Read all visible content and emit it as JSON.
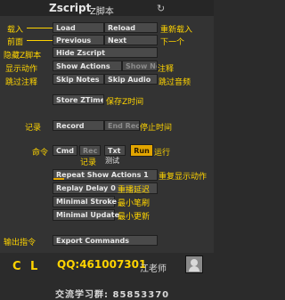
{
  "panel": {
    "title": "Zscript",
    "title_note": "Z脚本",
    "refresh_icon": "↻"
  },
  "buttons": {
    "load": "Load",
    "reload": "Reload",
    "previous": "Previous",
    "next": "Next",
    "hide_zscript": "Hide Zscript",
    "show_actions": "Show Actions",
    "show_notes": "Show Notes",
    "skip_notes": "Skip Notes",
    "skip_audio": "Skip Audio",
    "store_ztime": "Store ZTime",
    "record": "Record",
    "end_rec": "End Rec",
    "cmd": "Cmd",
    "rec": "Rec",
    "txt": "Txt",
    "run": "Run",
    "export_commands": "Export Commands"
  },
  "sliders": {
    "repeat_show_actions": {
      "label": "Repeat Show Actions",
      "value": "1",
      "level": 0.1
    },
    "replay_delay": {
      "label": "Replay Delay",
      "value": "0",
      "level": 0.0
    },
    "minimal_stroke": {
      "label": "Minimal Stroke",
      "value": "",
      "level": 0.0
    },
    "minimal_update": {
      "label": "Minimal Update",
      "value": "",
      "level": 0.0
    }
  },
  "annotations": {
    "load": "载入",
    "reload": "重新载入",
    "previous": "前面",
    "next": "下一个",
    "hide": "隐藏Z脚本",
    "show_actions": "显示动作",
    "show_notes": "注释",
    "skip_notes": "跳过注释",
    "skip_audio": "跳过音频",
    "store_ztime": "保存Z时间",
    "record": "记录",
    "end_rec": "停止时间",
    "cmd": "命令",
    "rec": "记录",
    "txt": "测试",
    "run": "运行",
    "repeat": "重复显示动作",
    "replay": "重播延迟",
    "min_stroke": "最小笔刷",
    "min_update": "最小更新",
    "export": "输出指令"
  },
  "footer": {
    "logo_c": "C",
    "logo_l": "L",
    "qq": "QQ:461007301",
    "teacher": "江老师",
    "group": "交流学习群: 85853370"
  },
  "colors": {
    "accent": "#e2a500",
    "annotation": "#ffd400",
    "panel_bg": "#333333"
  }
}
